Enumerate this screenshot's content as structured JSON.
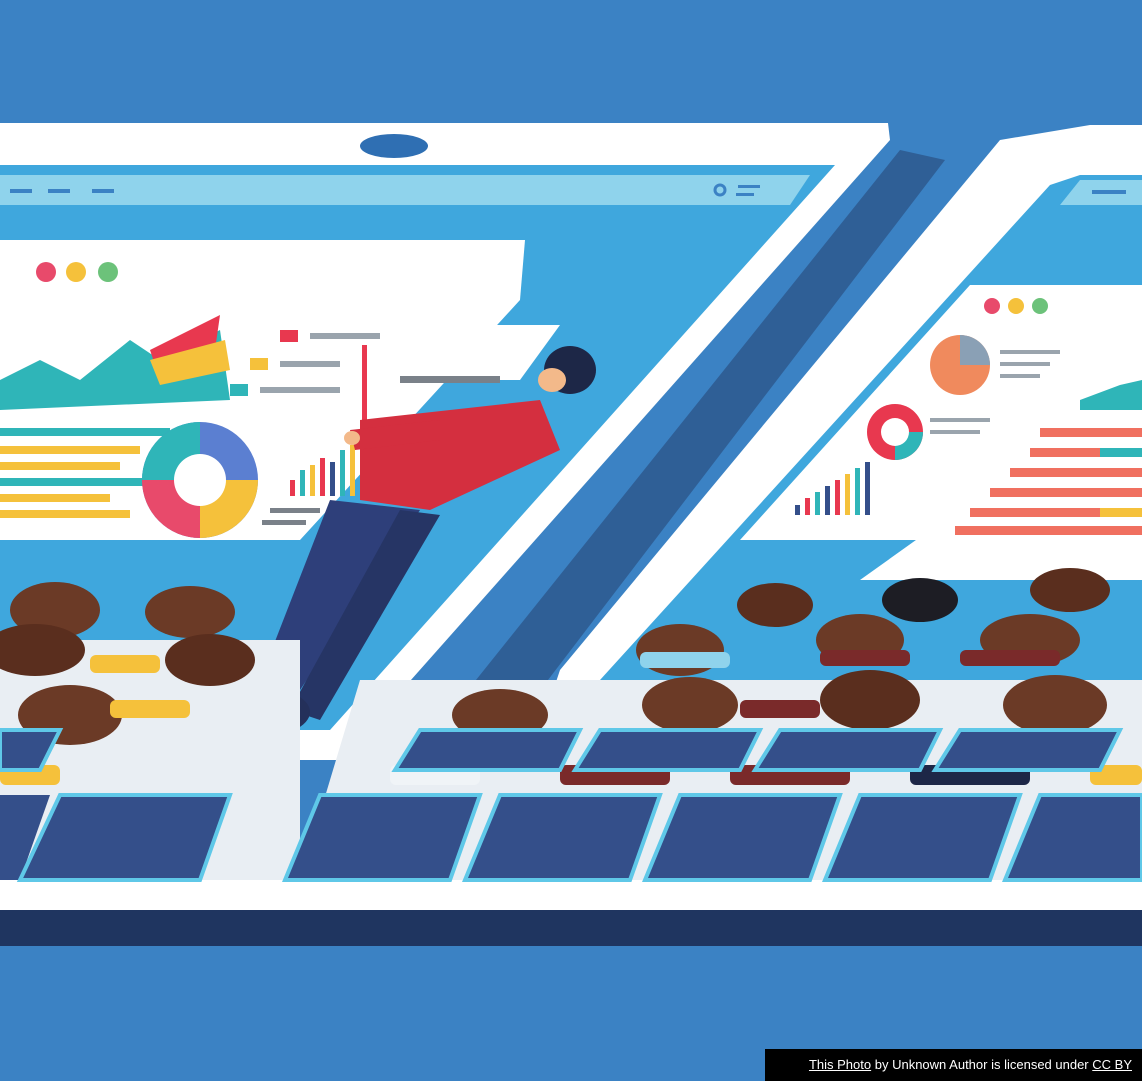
{
  "attribution": {
    "photo_link": "This Photo",
    "middle_text": " by Unknown Author is licensed under ",
    "license_link": "CC BY"
  },
  "colors": {
    "background": "#3b82c4",
    "screen": "#3fa7dd",
    "frame": "#ffffff",
    "seat": "#344f8a",
    "presenter_shirt": "#d42f3f"
  }
}
